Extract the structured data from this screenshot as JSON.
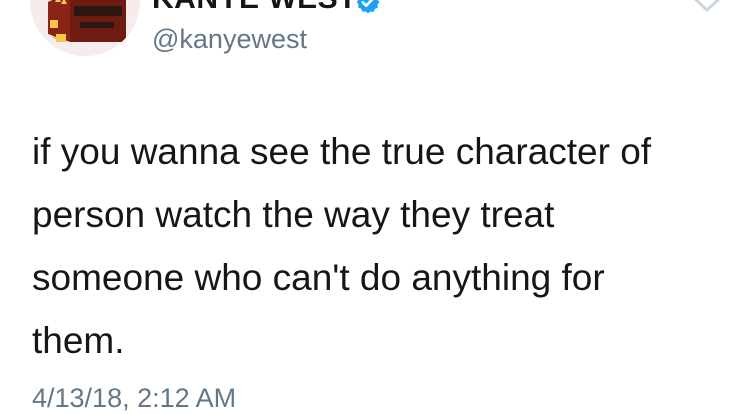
{
  "tweet": {
    "author": {
      "display_name": "KANYE WEST",
      "handle": "@kanyewest",
      "verified": true,
      "avatar_icon": "avatar-image"
    },
    "text_lines": [
      "if you wanna see the true character of",
      "person watch the way they treat",
      "someone who can't do anything for",
      "them."
    ],
    "timestamp": "4/13/18, 2:12 AM"
  },
  "colors": {
    "text": "#14171a",
    "secondary_text": "#657786",
    "verified_blue": "#1da1f2",
    "chevron": "#ccd6dd"
  },
  "icons": {
    "verified": "verified-badge-icon",
    "menu": "chevron-down-icon"
  }
}
